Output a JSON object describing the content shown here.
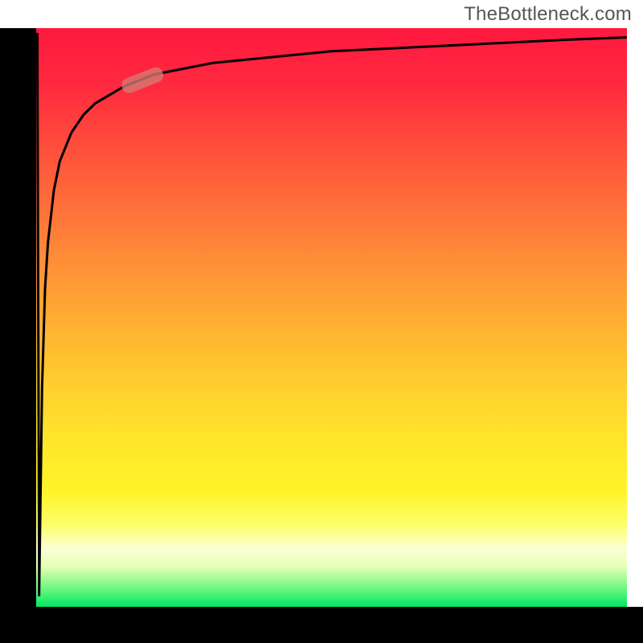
{
  "watermark": "TheBottleneck.com",
  "colors": {
    "axis": "#000000",
    "curve": "#000000",
    "marker": "#d37b73",
    "gradient_top": "#ff1840",
    "gradient_mid": "#ffe32c",
    "gradient_bot": "#00e865"
  },
  "chart_data": {
    "type": "line",
    "title": "",
    "xlabel": "",
    "ylabel": "",
    "xlim": [
      0,
      100
    ],
    "ylim": [
      0,
      100
    ],
    "series": [
      {
        "name": "bottleneck-curve",
        "x": [
          0.5,
          1,
          1.5,
          2,
          3,
          4,
          6,
          8,
          10,
          15,
          20,
          25,
          30,
          40,
          50,
          60,
          70,
          80,
          90,
          100
        ],
        "y": [
          2,
          38,
          55,
          63,
          72,
          77,
          82,
          85,
          87,
          90,
          92,
          93,
          94,
          95,
          96,
          96.5,
          97,
          97.5,
          98,
          98.4
        ]
      }
    ],
    "annotations": [
      {
        "name": "marker-pill",
        "x": 18,
        "y": 91
      }
    ],
    "grid": false,
    "legend": false
  }
}
